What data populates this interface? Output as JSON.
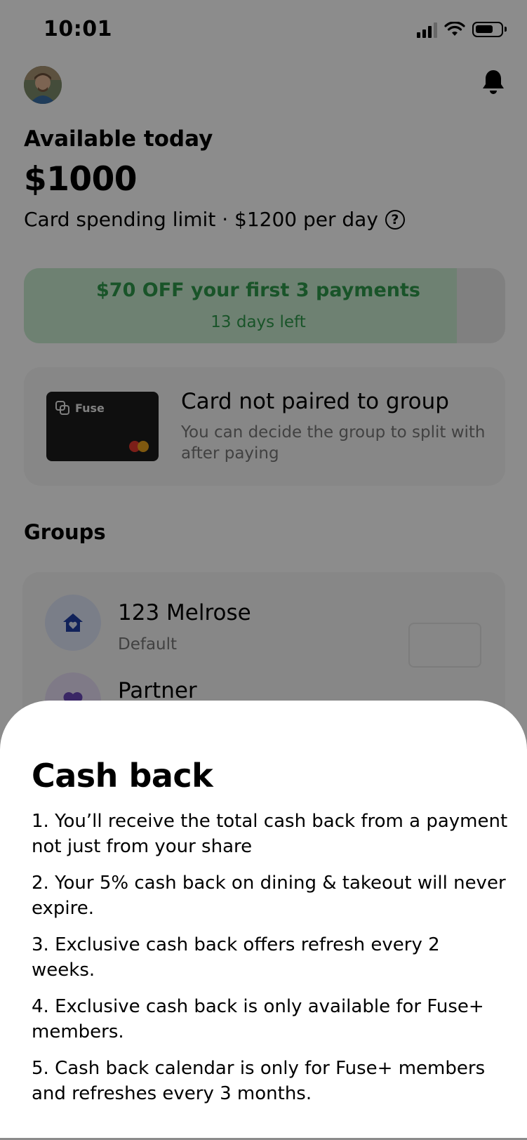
{
  "status_bar": {
    "time": "10:01"
  },
  "header": {
    "avatar_icon": "user-avatar",
    "notification_icon": "bell-icon"
  },
  "balance": {
    "label": "Available today",
    "amount": "$1000",
    "limit_text": "Card spending limit · $1200 per day",
    "help_glyph": "?"
  },
  "promo": {
    "title": "$70 OFF your first 3 payments",
    "subtitle": "13 days left",
    "progress": 0.9,
    "fill_color": "#c9ecd0",
    "text_color": "#2f9a4b"
  },
  "card": {
    "brand": "Fuse",
    "title": "Card not paired to group",
    "subtitle": "You can decide the group to split with after paying"
  },
  "groups": {
    "heading": "Groups",
    "items": [
      {
        "name": "123 Melrose",
        "subtitle": "Default",
        "icon": "house-heart-icon",
        "icon_bg": "#dfe5f8",
        "icon_color": "#1f3fa5"
      },
      {
        "name": "Partner",
        "subtitle": "",
        "icon": "heart-icon",
        "icon_bg": "#e7def6",
        "icon_color": "#6a48b8"
      }
    ]
  },
  "sheet": {
    "title": "Cash back",
    "items": [
      "1. You’ll receive the total cash back from a payment not just from your share",
      "2. Your 5% cash back on dining & takeout will never expire.",
      "3. Exclusive cash back offers refresh every 2 weeks.",
      "4. Exclusive cash back is only available for Fuse+ members.",
      "5. Cash back calendar is only for Fuse+ members and refreshes every 3 months."
    ]
  }
}
